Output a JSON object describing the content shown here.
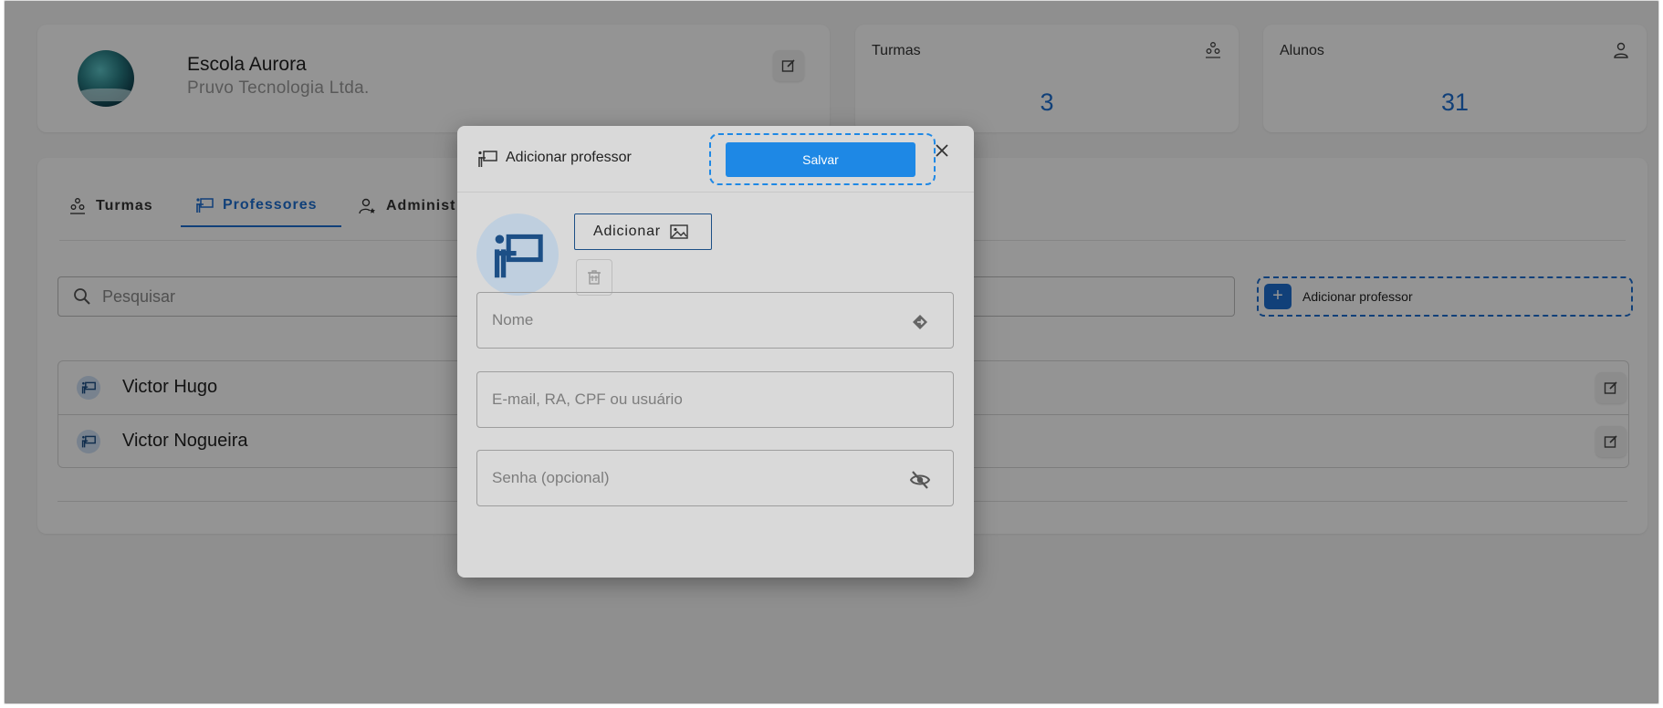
{
  "school": {
    "name": "Escola Aurora",
    "company": "Pruvo Tecnologia Ltda."
  },
  "stats": [
    {
      "label": "Turmas",
      "value": "3",
      "icon": "classes-icon"
    },
    {
      "label": "Alunos",
      "value": "31",
      "icon": "person-icon"
    }
  ],
  "tabs": [
    {
      "label": "Turmas",
      "icon": "classes-icon",
      "active": false
    },
    {
      "label": "Professores",
      "icon": "teacher-icon",
      "active": true
    },
    {
      "label": "Administ",
      "icon": "admin-icon",
      "active": false
    }
  ],
  "search": {
    "placeholder": "Pesquisar"
  },
  "add_button": {
    "label": "Adicionar professor",
    "plus": "+"
  },
  "teachers": [
    {
      "name": "Victor Hugo"
    },
    {
      "name": "Victor Nogueira"
    }
  ],
  "modal": {
    "title": "Adicionar professor",
    "save_label": "Salvar",
    "add_image_label": "Adicionar",
    "fields": {
      "name_placeholder": "Nome",
      "login_placeholder": "E-mail, RA, CPF ou usuário",
      "password_placeholder": "Senha (opcional)"
    }
  },
  "colors": {
    "accent": "#1e6fd0",
    "save_button": "#1e88e5",
    "overlay": "rgba(0,0,0,0.42)"
  }
}
